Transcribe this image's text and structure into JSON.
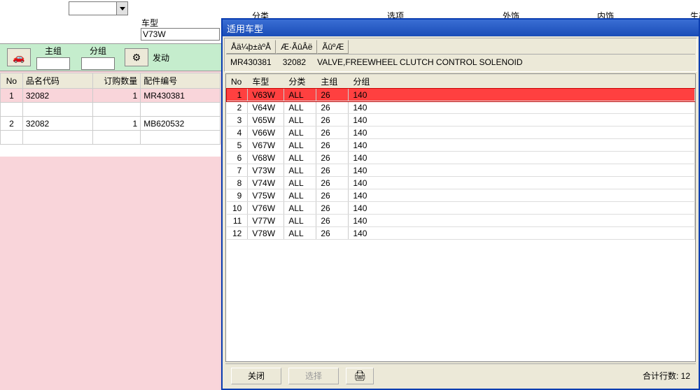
{
  "background": {
    "vehicle_label": "车型",
    "vehicle_value": "V73W",
    "top_labels": [
      "主组",
      "分组"
    ],
    "far_labels": [
      "分类",
      "选项",
      "外饰",
      "内饰",
      "生产"
    ],
    "toolbar_right": "发动",
    "table": {
      "headers": [
        "No",
        "品名代码",
        "订购数量",
        "配件编号"
      ],
      "rows": [
        {
          "no": "1",
          "code": "32082",
          "qty": "1",
          "part": "MR430381",
          "sel": true
        },
        {
          "no": "2",
          "code": "32082",
          "qty": "1",
          "part": "MB620532",
          "sel": false
        }
      ]
    }
  },
  "dialog": {
    "title": "适用车型",
    "header_cols": [
      "Åä¼þ±àºÅ",
      "Æ·ÃûÂë",
      "ÃûºÆ"
    ],
    "part_no": "MR430381",
    "code": "32082",
    "name": "VALVE,FREEWHEEL CLUTCH CONTROL SOLENOID",
    "table_headers": [
      "No",
      "车型",
      "分类",
      "主组",
      "分组"
    ],
    "rows": [
      {
        "no": "1",
        "model": "V63W",
        "cat": "ALL",
        "main": "26",
        "sub": "140"
      },
      {
        "no": "2",
        "model": "V64W",
        "cat": "ALL",
        "main": "26",
        "sub": "140"
      },
      {
        "no": "3",
        "model": "V65W",
        "cat": "ALL",
        "main": "26",
        "sub": "140"
      },
      {
        "no": "4",
        "model": "V66W",
        "cat": "ALL",
        "main": "26",
        "sub": "140"
      },
      {
        "no": "5",
        "model": "V67W",
        "cat": "ALL",
        "main": "26",
        "sub": "140"
      },
      {
        "no": "6",
        "model": "V68W",
        "cat": "ALL",
        "main": "26",
        "sub": "140"
      },
      {
        "no": "7",
        "model": "V73W",
        "cat": "ALL",
        "main": "26",
        "sub": "140"
      },
      {
        "no": "8",
        "model": "V74W",
        "cat": "ALL",
        "main": "26",
        "sub": "140"
      },
      {
        "no": "9",
        "model": "V75W",
        "cat": "ALL",
        "main": "26",
        "sub": "140"
      },
      {
        "no": "10",
        "model": "V76W",
        "cat": "ALL",
        "main": "26",
        "sub": "140"
      },
      {
        "no": "11",
        "model": "V77W",
        "cat": "ALL",
        "main": "26",
        "sub": "140"
      },
      {
        "no": "12",
        "model": "V78W",
        "cat": "ALL",
        "main": "26",
        "sub": "140"
      }
    ],
    "close_label": "关闭",
    "select_label": "选择",
    "total_label": "合计行数: ",
    "total_value": "12"
  }
}
